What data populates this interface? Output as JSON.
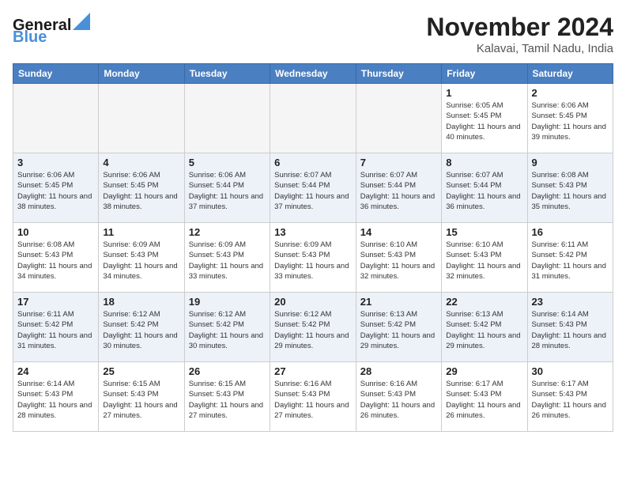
{
  "header": {
    "logo_line1": "General",
    "logo_line2": "Blue",
    "month": "November 2024",
    "location": "Kalavai, Tamil Nadu, India"
  },
  "weekdays": [
    "Sunday",
    "Monday",
    "Tuesday",
    "Wednesday",
    "Thursday",
    "Friday",
    "Saturday"
  ],
  "weeks": [
    [
      {
        "day": "",
        "sunrise": "",
        "sunset": "",
        "daylight": ""
      },
      {
        "day": "",
        "sunrise": "",
        "sunset": "",
        "daylight": ""
      },
      {
        "day": "",
        "sunrise": "",
        "sunset": "",
        "daylight": ""
      },
      {
        "day": "",
        "sunrise": "",
        "sunset": "",
        "daylight": ""
      },
      {
        "day": "",
        "sunrise": "",
        "sunset": "",
        "daylight": ""
      },
      {
        "day": "1",
        "sunrise": "Sunrise: 6:05 AM",
        "sunset": "Sunset: 5:45 PM",
        "daylight": "Daylight: 11 hours and 40 minutes."
      },
      {
        "day": "2",
        "sunrise": "Sunrise: 6:06 AM",
        "sunset": "Sunset: 5:45 PM",
        "daylight": "Daylight: 11 hours and 39 minutes."
      }
    ],
    [
      {
        "day": "3",
        "sunrise": "Sunrise: 6:06 AM",
        "sunset": "Sunset: 5:45 PM",
        "daylight": "Daylight: 11 hours and 38 minutes."
      },
      {
        "day": "4",
        "sunrise": "Sunrise: 6:06 AM",
        "sunset": "Sunset: 5:45 PM",
        "daylight": "Daylight: 11 hours and 38 minutes."
      },
      {
        "day": "5",
        "sunrise": "Sunrise: 6:06 AM",
        "sunset": "Sunset: 5:44 PM",
        "daylight": "Daylight: 11 hours and 37 minutes."
      },
      {
        "day": "6",
        "sunrise": "Sunrise: 6:07 AM",
        "sunset": "Sunset: 5:44 PM",
        "daylight": "Daylight: 11 hours and 37 minutes."
      },
      {
        "day": "7",
        "sunrise": "Sunrise: 6:07 AM",
        "sunset": "Sunset: 5:44 PM",
        "daylight": "Daylight: 11 hours and 36 minutes."
      },
      {
        "day": "8",
        "sunrise": "Sunrise: 6:07 AM",
        "sunset": "Sunset: 5:44 PM",
        "daylight": "Daylight: 11 hours and 36 minutes."
      },
      {
        "day": "9",
        "sunrise": "Sunrise: 6:08 AM",
        "sunset": "Sunset: 5:43 PM",
        "daylight": "Daylight: 11 hours and 35 minutes."
      }
    ],
    [
      {
        "day": "10",
        "sunrise": "Sunrise: 6:08 AM",
        "sunset": "Sunset: 5:43 PM",
        "daylight": "Daylight: 11 hours and 34 minutes."
      },
      {
        "day": "11",
        "sunrise": "Sunrise: 6:09 AM",
        "sunset": "Sunset: 5:43 PM",
        "daylight": "Daylight: 11 hours and 34 minutes."
      },
      {
        "day": "12",
        "sunrise": "Sunrise: 6:09 AM",
        "sunset": "Sunset: 5:43 PM",
        "daylight": "Daylight: 11 hours and 33 minutes."
      },
      {
        "day": "13",
        "sunrise": "Sunrise: 6:09 AM",
        "sunset": "Sunset: 5:43 PM",
        "daylight": "Daylight: 11 hours and 33 minutes."
      },
      {
        "day": "14",
        "sunrise": "Sunrise: 6:10 AM",
        "sunset": "Sunset: 5:43 PM",
        "daylight": "Daylight: 11 hours and 32 minutes."
      },
      {
        "day": "15",
        "sunrise": "Sunrise: 6:10 AM",
        "sunset": "Sunset: 5:43 PM",
        "daylight": "Daylight: 11 hours and 32 minutes."
      },
      {
        "day": "16",
        "sunrise": "Sunrise: 6:11 AM",
        "sunset": "Sunset: 5:42 PM",
        "daylight": "Daylight: 11 hours and 31 minutes."
      }
    ],
    [
      {
        "day": "17",
        "sunrise": "Sunrise: 6:11 AM",
        "sunset": "Sunset: 5:42 PM",
        "daylight": "Daylight: 11 hours and 31 minutes."
      },
      {
        "day": "18",
        "sunrise": "Sunrise: 6:12 AM",
        "sunset": "Sunset: 5:42 PM",
        "daylight": "Daylight: 11 hours and 30 minutes."
      },
      {
        "day": "19",
        "sunrise": "Sunrise: 6:12 AM",
        "sunset": "Sunset: 5:42 PM",
        "daylight": "Daylight: 11 hours and 30 minutes."
      },
      {
        "day": "20",
        "sunrise": "Sunrise: 6:12 AM",
        "sunset": "Sunset: 5:42 PM",
        "daylight": "Daylight: 11 hours and 29 minutes."
      },
      {
        "day": "21",
        "sunrise": "Sunrise: 6:13 AM",
        "sunset": "Sunset: 5:42 PM",
        "daylight": "Daylight: 11 hours and 29 minutes."
      },
      {
        "day": "22",
        "sunrise": "Sunrise: 6:13 AM",
        "sunset": "Sunset: 5:42 PM",
        "daylight": "Daylight: 11 hours and 29 minutes."
      },
      {
        "day": "23",
        "sunrise": "Sunrise: 6:14 AM",
        "sunset": "Sunset: 5:43 PM",
        "daylight": "Daylight: 11 hours and 28 minutes."
      }
    ],
    [
      {
        "day": "24",
        "sunrise": "Sunrise: 6:14 AM",
        "sunset": "Sunset: 5:43 PM",
        "daylight": "Daylight: 11 hours and 28 minutes."
      },
      {
        "day": "25",
        "sunrise": "Sunrise: 6:15 AM",
        "sunset": "Sunset: 5:43 PM",
        "daylight": "Daylight: 11 hours and 27 minutes."
      },
      {
        "day": "26",
        "sunrise": "Sunrise: 6:15 AM",
        "sunset": "Sunset: 5:43 PM",
        "daylight": "Daylight: 11 hours and 27 minutes."
      },
      {
        "day": "27",
        "sunrise": "Sunrise: 6:16 AM",
        "sunset": "Sunset: 5:43 PM",
        "daylight": "Daylight: 11 hours and 27 minutes."
      },
      {
        "day": "28",
        "sunrise": "Sunrise: 6:16 AM",
        "sunset": "Sunset: 5:43 PM",
        "daylight": "Daylight: 11 hours and 26 minutes."
      },
      {
        "day": "29",
        "sunrise": "Sunrise: 6:17 AM",
        "sunset": "Sunset: 5:43 PM",
        "daylight": "Daylight: 11 hours and 26 minutes."
      },
      {
        "day": "30",
        "sunrise": "Sunrise: 6:17 AM",
        "sunset": "Sunset: 5:43 PM",
        "daylight": "Daylight: 11 hours and 26 minutes."
      }
    ]
  ]
}
